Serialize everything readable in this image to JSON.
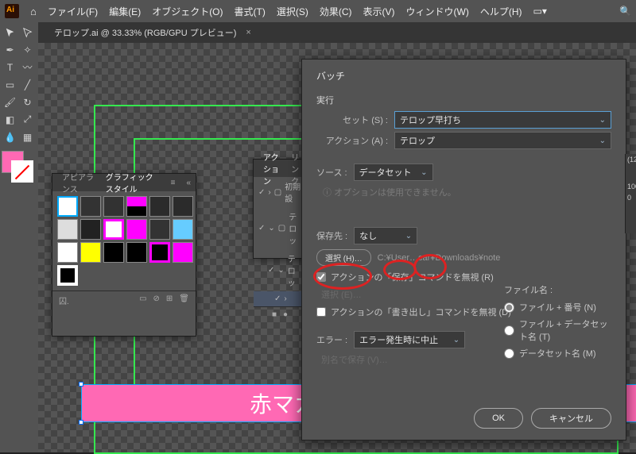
{
  "menubar": {
    "items": [
      "ファイル(F)",
      "編集(E)",
      "オブジェクト(O)",
      "書式(T)",
      "選択(S)",
      "効果(C)",
      "表示(V)",
      "ウィンドウ(W)",
      "ヘルプ(H)"
    ]
  },
  "document": {
    "tab_label": "テロップ.ai @ 33.33% (RGB/GPU プレビュー)",
    "telop_text": "赤マカロン"
  },
  "appearance_panel": {
    "tab1": "アピアランス",
    "tab2": "グラフィックスタイル",
    "footer_label": "囚."
  },
  "actions_panel": {
    "tab1": "アクション",
    "tab2": "リンク",
    "item_root": "初期設",
    "item_group": "テロッ",
    "item_action": "テロッ"
  },
  "batch": {
    "title": "バッチ",
    "section_exec": "実行",
    "set_label": "セット (S) :",
    "set_value": "テロップ早打ち",
    "action_label": "アクション (A) :",
    "action_value": "テロップ",
    "source_label": "ソース :",
    "source_value": "データセット",
    "options_note": "オプションは使用できません。",
    "dest_label": "保存先 :",
    "dest_value": "なし",
    "choose_btn": "選択 (H)…",
    "path_text": "C:¥User…car¥Downloads¥note",
    "override_save": "アクションの「保存」コマンドを無視 (R)",
    "choose_export": "選択 (E)…",
    "override_export": "アクションの「書き出し」コマンドを無視 (D)",
    "filename_label": "ファイル名 :",
    "radio_file_number": "ファイル + 番号 (N)",
    "radio_file_dataset": "ファイル + データセット名 (T)",
    "radio_dataset": "データセット名 (M)",
    "error_label": "エラー :",
    "error_value": "エラー発生時に中止",
    "saveas_disabled": "別名で保存 (V)…",
    "ok": "OK",
    "cancel": "キャンセル"
  },
  "right_sliver": {
    "label1": "(12",
    "label2": "100",
    "label3": "0"
  }
}
